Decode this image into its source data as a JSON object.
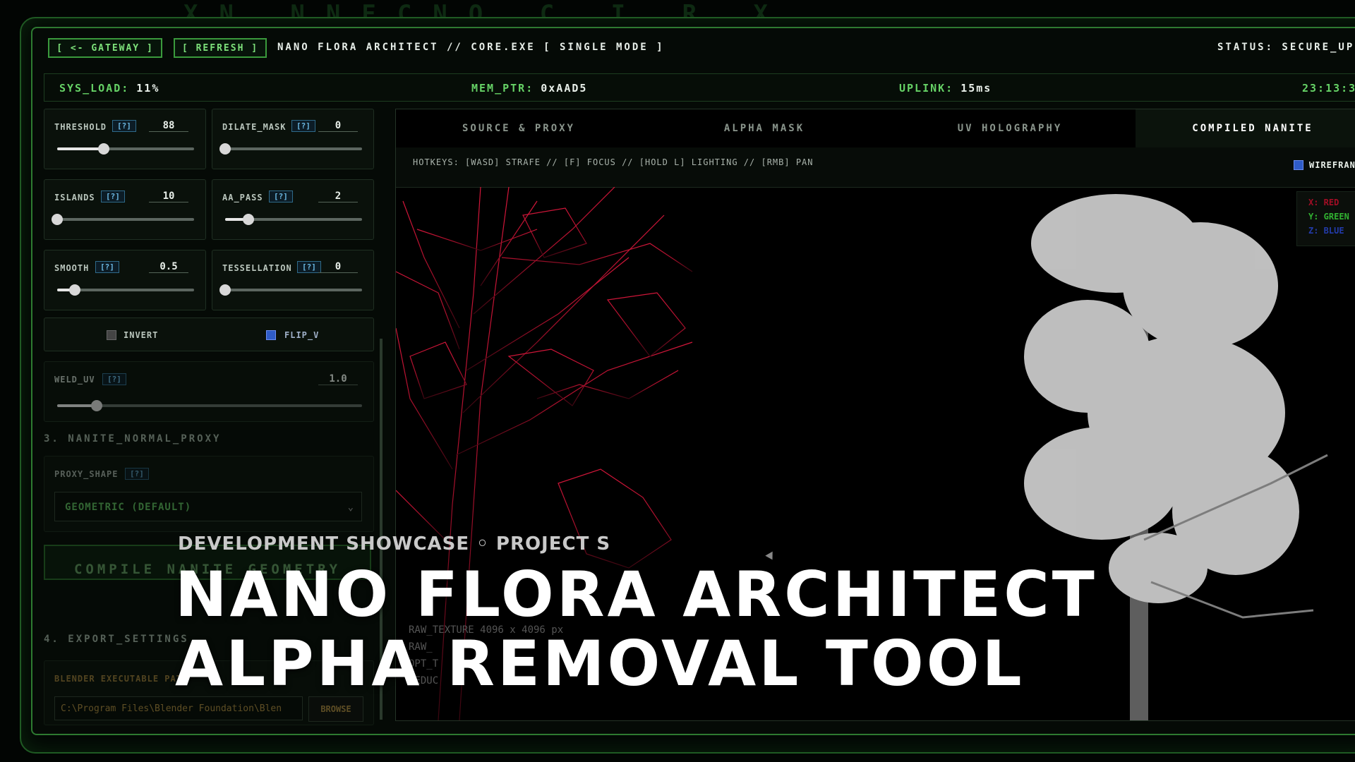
{
  "header": {
    "gateway_label": "[ <- GATEWAY ]",
    "refresh_label": "[ REFRESH ]",
    "title": "NANO FLORA ARCHITECT // CORE.EXE [ SINGLE MODE ]",
    "status": "STATUS: SECURE_UPL"
  },
  "stats": {
    "sys_load_key": "SYS_LOAD:",
    "sys_load_val": "11%",
    "mem_ptr_key": "MEM_PTR:",
    "mem_ptr_val": "0xAAD5",
    "uplink_key": "UPLINK:",
    "uplink_val": "15ms",
    "clock": "23:13:3"
  },
  "params": [
    {
      "label": "THRESHOLD",
      "help": "[?]",
      "value": "88",
      "level": 0.34
    },
    {
      "label": "DILATE_MASK",
      "help": "[?]",
      "value": "0",
      "level": 0.0
    },
    {
      "label": "ISLANDS",
      "help": "[?]",
      "value": "10",
      "level": 0.0
    },
    {
      "label": "AA_PASS",
      "help": "[?]",
      "value": "2",
      "level": 0.17
    },
    {
      "label": "SMOOTH",
      "help": "[?]",
      "value": "0.5",
      "level": 0.13
    },
    {
      "label": "TESSELLATION",
      "help": "[?]",
      "value": "0",
      "level": 0.0
    }
  ],
  "toggles": {
    "invert_label": "INVERT",
    "invert_checked": false,
    "flipv_label": "FLIP_V",
    "flipv_checked": true
  },
  "weld": {
    "label": "WELD_UV",
    "help": "[?]",
    "value": "1.0",
    "level": 0.13
  },
  "section3": "3. NANITE_NORMAL_PROXY",
  "proxy": {
    "label": "PROXY_SHAPE",
    "help": "[?]",
    "selected": "GEOMETRIC (DEFAULT)"
  },
  "compile_label": "COMPILE NANITE GEOMETRY",
  "section4": "4. EXPORT_SETTINGS",
  "blender": {
    "label": "BLENDER EXECUTABLE PATH",
    "path": "C:\\Program Files\\Blender Foundation\\Blen",
    "browse": "BROWSE"
  },
  "tabs": [
    "SOURCE & PROXY",
    "ALPHA MASK",
    "UV HOLOGRAPHY",
    "COMPILED NANITE"
  ],
  "active_tab": 3,
  "hotkeys": "HOTKEYS: [WASD] STRAFE // [F] FOCUS // [HOLD L] LIGHTING // [RMB] PAN",
  "wireframe_label": "WIREFRAN",
  "axis": {
    "x": "X: RED",
    "y": "Y: GREEN",
    "z": "Z: BLUE"
  },
  "stats_overlay": {
    "raw": "RAW_TEXTURE 4096 x 4096 px",
    "raw2": "RAW_",
    "opt": "OPT_T",
    "red": "REDUC"
  },
  "overlay": {
    "kicker": "DEVELOPMENT SHOWCASE ◦ PROJECT S",
    "line1": "NANO FLORA ARCHITECT",
    "line2": "ALPHA REMOVAL TOOL"
  },
  "colors": {
    "accent": "#3a9a3c",
    "wire_red": "#c0102c",
    "checkbox": "#2f5cc8"
  }
}
